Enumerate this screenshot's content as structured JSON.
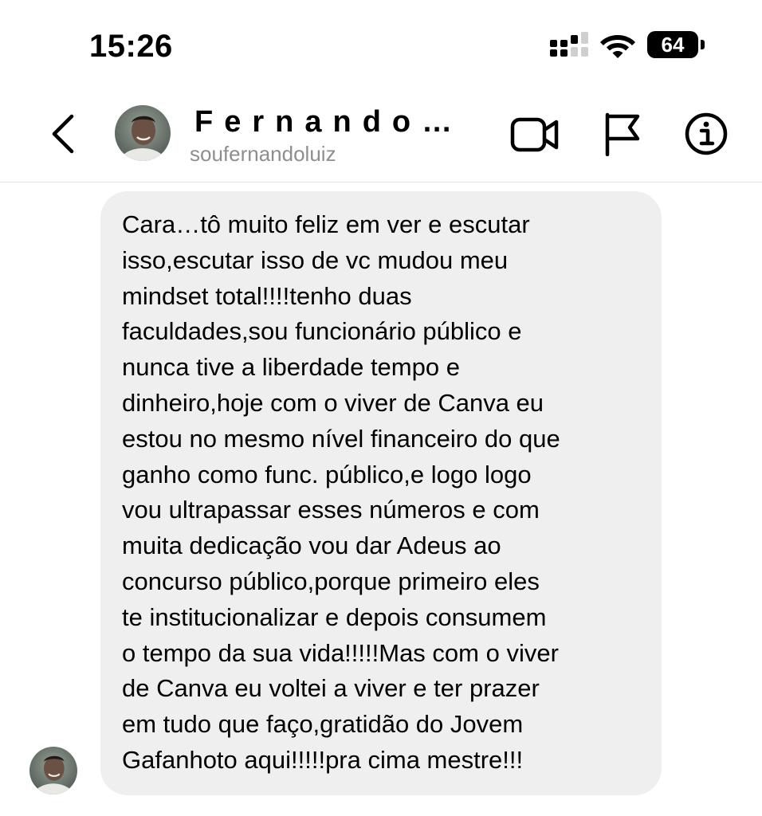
{
  "status_bar": {
    "time": "15:26",
    "battery": "64"
  },
  "header": {
    "name": "Fernando…",
    "username": "soufernandoluiz",
    "icons": [
      "chevron-left-icon",
      "video-camera-icon",
      "flag-icon",
      "info-icon"
    ]
  },
  "message": {
    "text": "Cara…tô muito feliz em ver e escutar\nisso,escutar isso de vc mudou meu\nmindset total!!!!tenho duas\nfaculdades,sou funcionário público e\nnunca tive a liberdade tempo e\ndinheiro,hoje com o viver de Canva eu\nestou no mesmo nível financeiro do que\nganho como func. público,e logo logo\nvou ultrapassar esses números e com\nmuita dedicação vou dar Adeus ao\nconcurso público,porque primeiro eles\nte institucionalizar e depois consumem\no tempo da sua vida!!!!!Mas com o viver\nde Canva eu voltei a viver e ter prazer\nem tudo que faço,gratidão do Jovem\nGafanhoto aqui!!!!!pra cima mestre!!!"
  },
  "colors": {
    "bubble_bg": "#efefef",
    "muted_text": "#8e8e8e",
    "divider": "#e3e3e3"
  }
}
